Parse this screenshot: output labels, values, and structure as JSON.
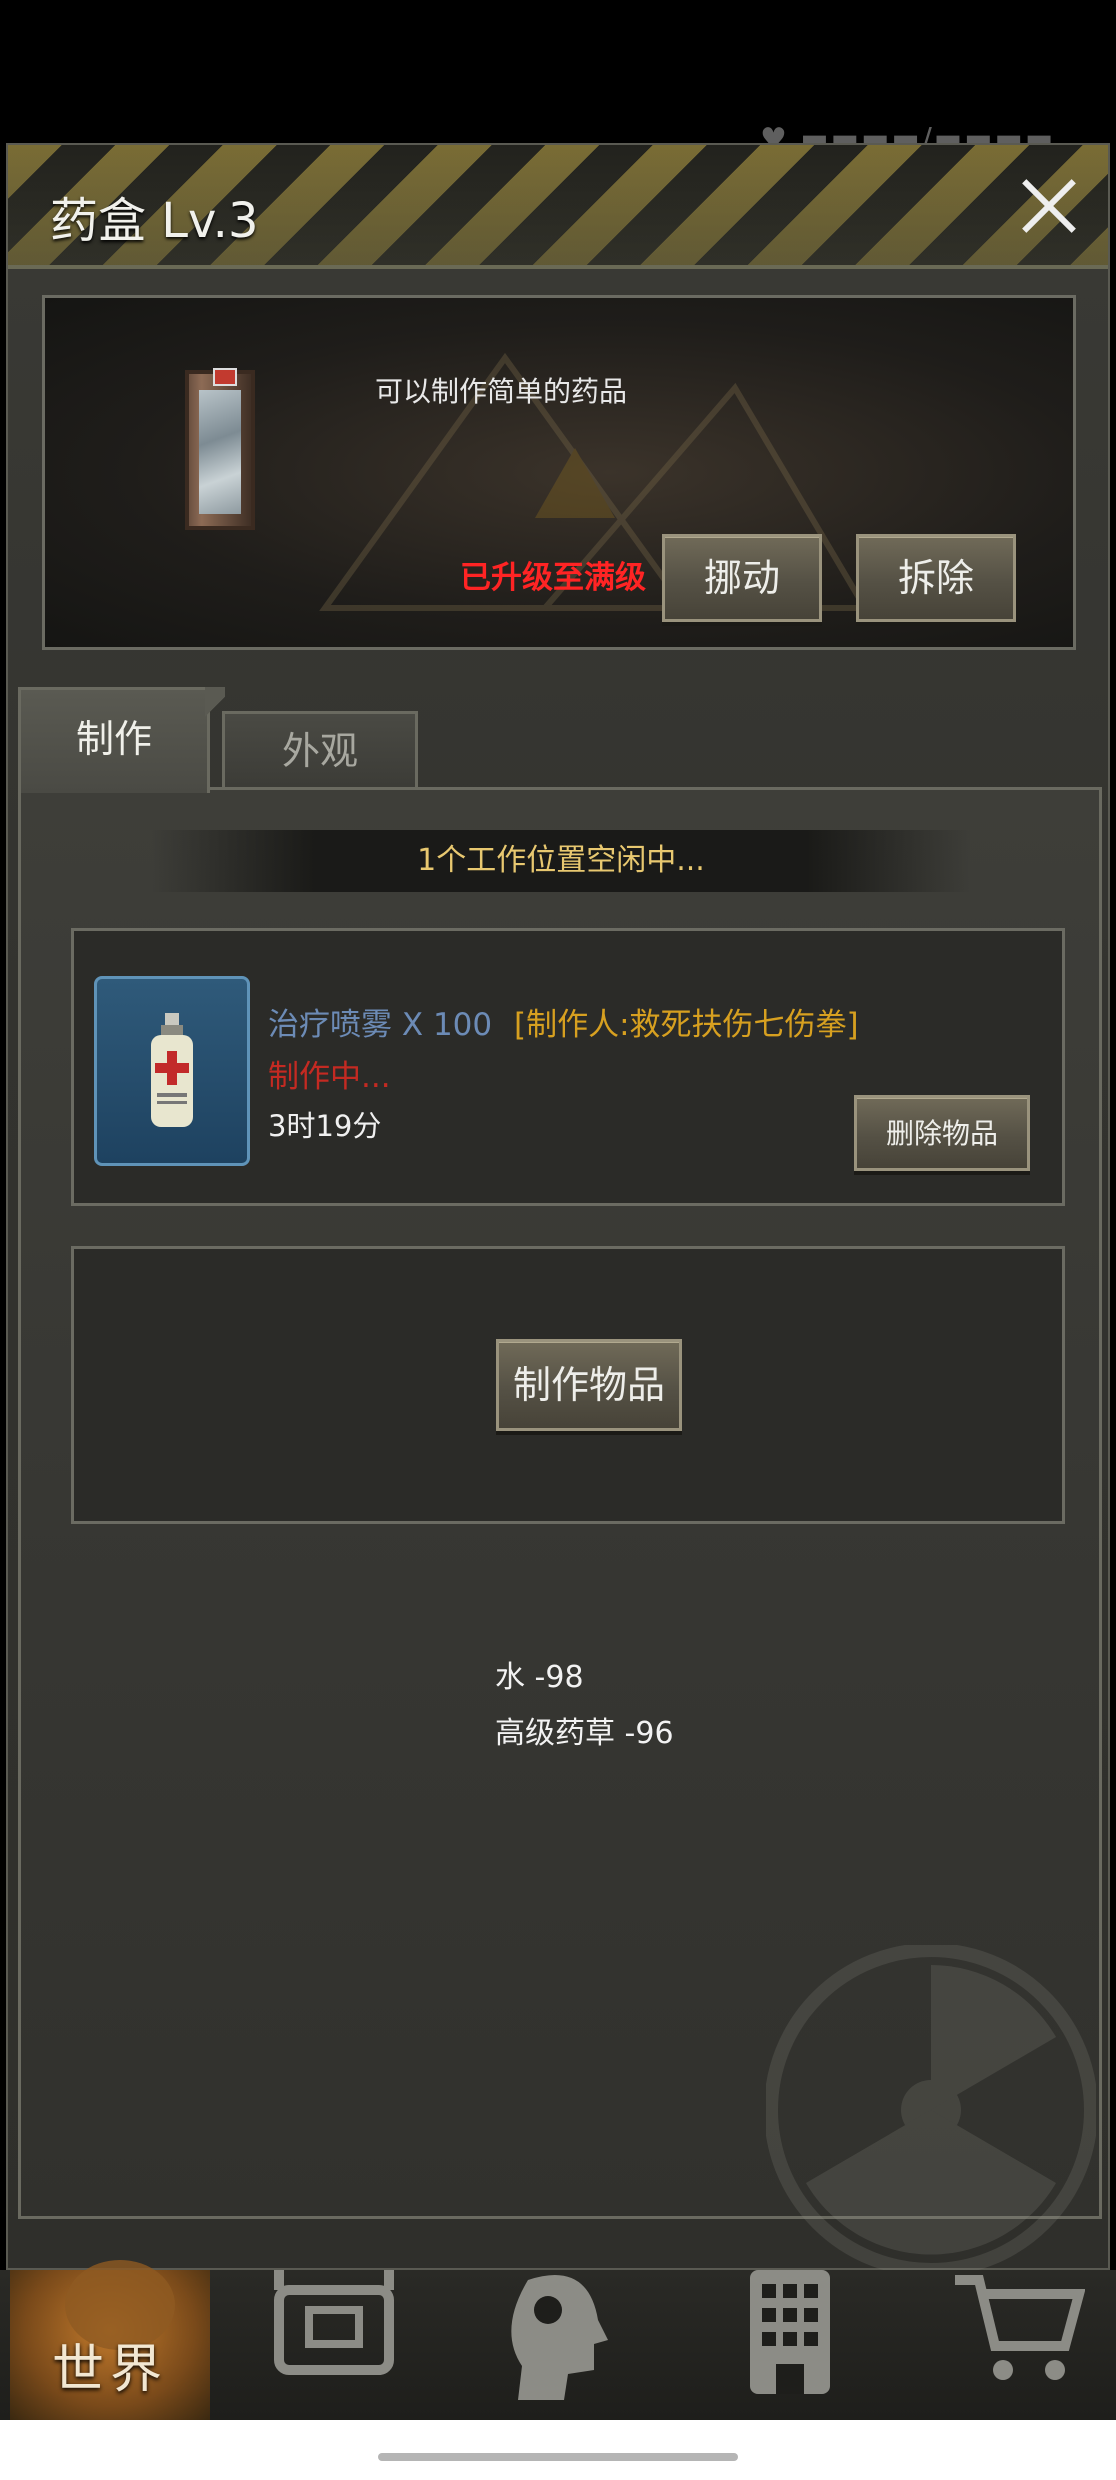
{
  "window": {
    "title": "药盒 Lv.3"
  },
  "info": {
    "description": "可以制作简单的药品",
    "status": "已升级至满级",
    "move_label": "挪动",
    "remove_label": "拆除"
  },
  "tabs": [
    {
      "label": "制作",
      "active": true
    },
    {
      "label": "外观",
      "active": false
    }
  ],
  "craft": {
    "slot_status": "1个工作位置空闲中...",
    "queue": [
      {
        "name": "治疗喷雾 X 100",
        "maker": "[制作人:救死扶伤七伤拳]",
        "status": "制作中...",
        "time_left": "3时19分",
        "delete_label": "删除物品",
        "icon": "spray-bottle-icon"
      }
    ],
    "craft_button_label": "制作物品",
    "costs": [
      "水 -98",
      "高级药草 -96"
    ]
  },
  "bottom_nav": [
    {
      "label": "世界",
      "icon": "globe-icon",
      "active": true
    },
    {
      "label": "",
      "icon": "backpack-icon"
    },
    {
      "label": "",
      "icon": "head-gear-icon"
    },
    {
      "label": "",
      "icon": "building-icon"
    },
    {
      "label": "",
      "icon": "cart-icon"
    }
  ],
  "colors": {
    "maxed_red": "#ff2424",
    "maker_orange": "#d7a020",
    "item_name_blue": "#6c8bb6",
    "banner_gold": "#e8c870",
    "crafting_red": "#c42a22"
  }
}
